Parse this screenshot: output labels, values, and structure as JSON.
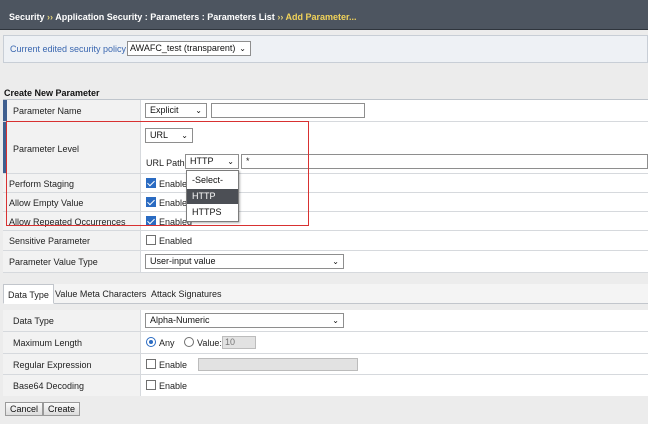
{
  "breadcrumb": {
    "items": [
      "Security",
      "Application Security : Parameters : Parameters List"
    ],
    "separator": "››",
    "current": "Add Parameter..."
  },
  "policy": {
    "label": "Current edited security policy",
    "value": "AWAFC_test (transparent)"
  },
  "section_title": "Create New Parameter",
  "parameter_name": {
    "label": "Parameter Name",
    "type": "Explicit",
    "value": ""
  },
  "parameter_level": {
    "label": "Parameter Level",
    "level": "URL",
    "url_path_label": "URL Path",
    "protocol": "HTTP",
    "path_value": "*"
  },
  "protocol_dropdown": {
    "options": [
      "-Select-",
      "HTTP",
      "HTTPS"
    ],
    "highlighted": "HTTP"
  },
  "perform_staging": {
    "label": "Perform Staging",
    "checkbox_label": "Enabled",
    "checked": true
  },
  "allow_empty": {
    "label": "Allow Empty Value",
    "checkbox_label": "Enabled",
    "checked": true
  },
  "allow_repeated": {
    "label": "Allow Repeated Occurrences",
    "checkbox_label": "Enabled",
    "checked": true
  },
  "sensitive": {
    "label": "Sensitive Parameter",
    "checkbox_label": "Enabled",
    "checked": false
  },
  "value_type": {
    "label": "Parameter Value Type",
    "value": "User-input value"
  },
  "tabs": [
    "Data Type",
    "Value Meta Characters",
    "Attack Signatures"
  ],
  "data_type": {
    "label": "Data Type",
    "value": "Alpha-Numeric"
  },
  "max_length": {
    "label": "Maximum Length",
    "any_label": "Any",
    "value_label": "Value:",
    "value": "10"
  },
  "regex": {
    "label": "Regular Expression",
    "checkbox_label": "Enable",
    "value": ""
  },
  "base64": {
    "label": "Base64 Decoding",
    "checkbox_label": "Enable"
  },
  "buttons": {
    "cancel": "Cancel",
    "create": "Create"
  },
  "colors": {
    "header_bg": "#4d5560",
    "accent": "#2a6bc2",
    "highlight_box": "#d83131",
    "current_crumb": "#f1d35a"
  }
}
